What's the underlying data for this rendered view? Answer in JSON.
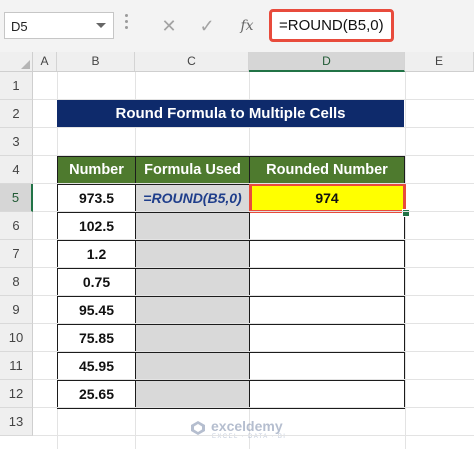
{
  "name_box": {
    "value": "D5"
  },
  "formula_bar": {
    "cancel_icon": "cancel-icon",
    "enter_icon": "check-icon",
    "fx_label": "fx",
    "value": "=ROUND(B5,0)"
  },
  "columns": [
    "A",
    "B",
    "C",
    "D",
    "E"
  ],
  "active_column": "D",
  "rows": [
    "1",
    "2",
    "3",
    "4",
    "5",
    "6",
    "7",
    "8",
    "9",
    "10",
    "11",
    "12",
    "13"
  ],
  "active_row": "5",
  "sheet": {
    "title": "Round Formula to Multiple Cells",
    "headers": {
      "number": "Number",
      "formula": "Formula Used",
      "rounded": "Rounded Number"
    },
    "numbers": [
      "973.5",
      "102.5",
      "1.2",
      "0.75",
      "95.45",
      "75.85",
      "45.95",
      "25.65"
    ],
    "formula_cell": "=ROUND(B5,0)",
    "rounded_cell": "974"
  },
  "watermark": {
    "name": "exceldemy",
    "tagline": "EXCEL · DATA · BI"
  },
  "colors": {
    "title_bg": "#0e2a6b",
    "header_bg": "#4e7a2e",
    "highlight": "#ffff00",
    "selection_border": "#e84b3c",
    "formula_text": "#1f3e8b"
  }
}
